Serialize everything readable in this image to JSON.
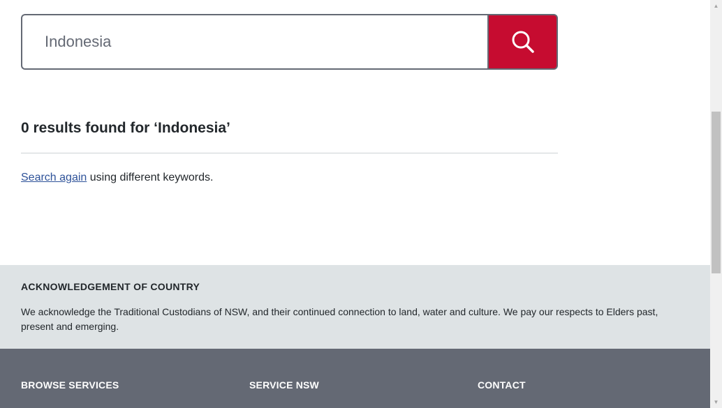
{
  "search": {
    "value": "Indonesia",
    "button_icon": "search-icon",
    "button_color": "#c60c30"
  },
  "results": {
    "heading": "0 results found for ‘Indonesia’",
    "search_again_link": "Search again",
    "hint_suffix": " using different keywords."
  },
  "acknowledgement": {
    "title": "ACKNOWLEDGEMENT OF COUNTRY",
    "text": "We acknowledge the Traditional Custodians of NSW, and their continued connection to land, water and culture. We pay our respects to Elders past, present and emerging."
  },
  "footer": {
    "headings": [
      "BROWSE SERVICES",
      "SERVICE NSW",
      "CONTACT"
    ]
  },
  "scrollbar": {
    "up_icon": "chevron-up-icon",
    "down_icon": "chevron-down-icon"
  }
}
